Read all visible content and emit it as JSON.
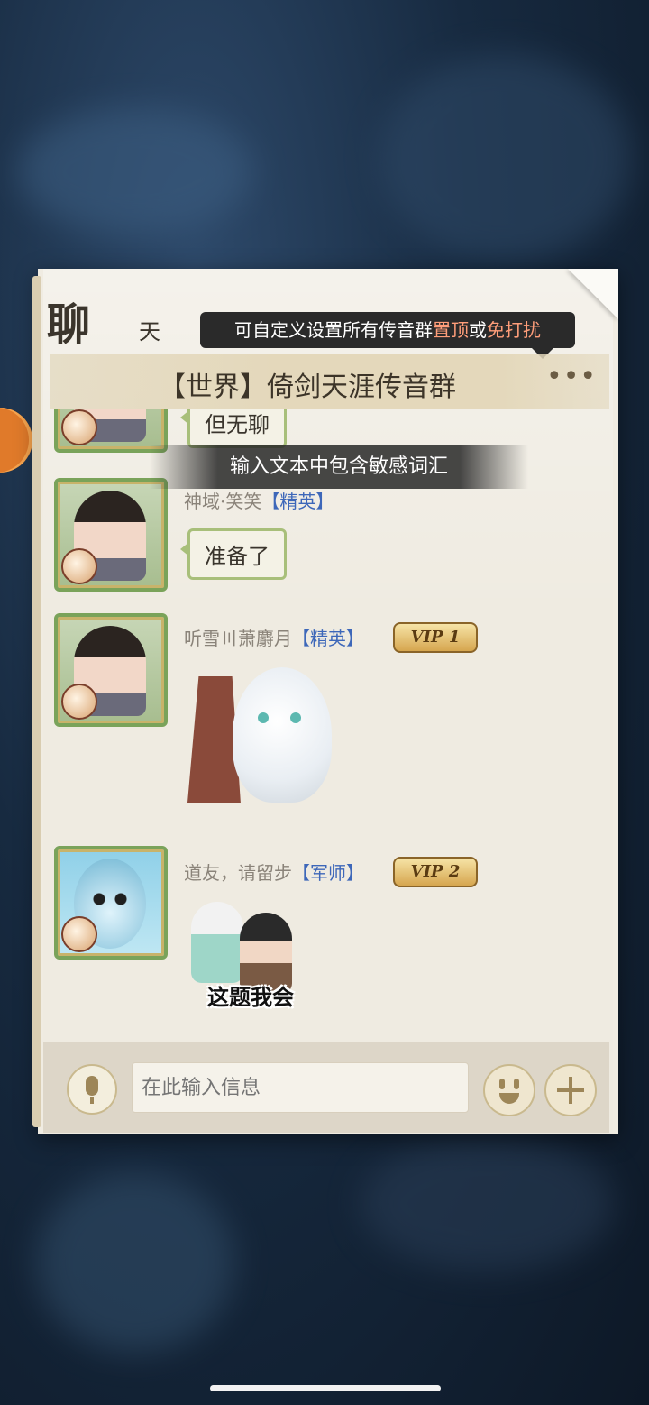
{
  "chat": {
    "title_main": "聊",
    "title_sub": "天",
    "tooltip": {
      "prefix": "可自定义设置所有传音群",
      "highlight1": "置顶",
      "middle": "或",
      "highlight2": "免打扰"
    },
    "channel_title": "【世界】倚剑天涯传音群",
    "more_label": "•••",
    "toast": "输入文本中包含敏感词汇",
    "messages": [
      {
        "bubble_text": "但无聊"
      },
      {
        "name": "神域·笑笑",
        "rank": "【精英】",
        "bubble_text": "准备了"
      },
      {
        "name": "听雪〣萧麝月",
        "rank": "【精英】",
        "vip": "VIP 1"
      },
      {
        "name": "道友，请留步",
        "rank": "【军师】",
        "vip": "VIP 2",
        "sticker_caption": "这题我会"
      }
    ],
    "input": {
      "placeholder": "在此输入信息"
    }
  },
  "colors": {
    "accent": "#ff9e7a",
    "rank": "#3d67b9",
    "bubble_border": "#a8bf7a"
  },
  "icons": [
    "mic-icon",
    "emoji-icon",
    "plus-icon",
    "more-icon"
  ]
}
